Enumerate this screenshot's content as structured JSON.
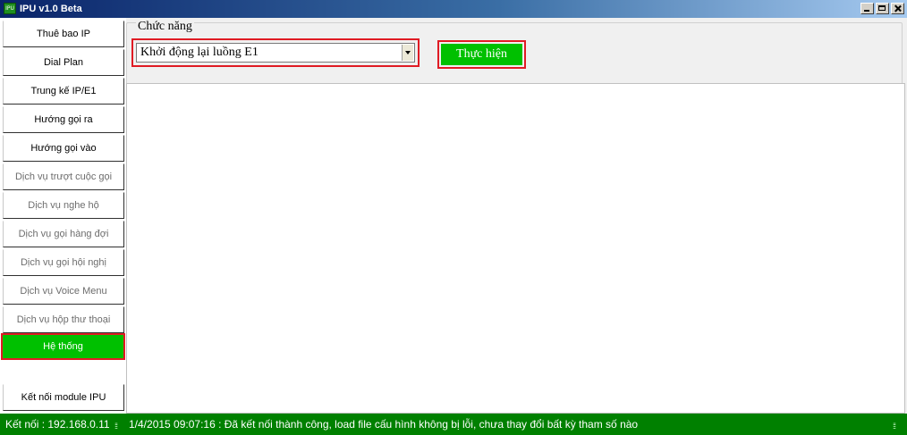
{
  "window": {
    "title": "IPU v1.0 Beta",
    "icon": "app-icon",
    "icon_text": "IPU"
  },
  "sidebar": {
    "items": [
      {
        "label": "Thuê bao IP",
        "state": "normal"
      },
      {
        "label": "Dial Plan",
        "state": "normal"
      },
      {
        "label": "Trung kế IP/E1",
        "state": "normal"
      },
      {
        "label": "Hướng gọi ra",
        "state": "normal"
      },
      {
        "label": "Hướng gọi vào",
        "state": "normal"
      },
      {
        "label": "Dịch vụ trượt cuộc gọi",
        "state": "disabled"
      },
      {
        "label": "Dịch vụ nghe hộ",
        "state": "disabled"
      },
      {
        "label": "Dịch vụ gọi hàng đợi",
        "state": "disabled"
      },
      {
        "label": "Dịch vụ gọi hội nghị",
        "state": "disabled"
      },
      {
        "label": "Dịch vụ Voice Menu",
        "state": "disabled"
      },
      {
        "label": "Dịch vụ hộp thư thoại",
        "state": "disabled"
      },
      {
        "label": "Hệ thống",
        "state": "active"
      },
      {
        "label": "Kết nối module IPU",
        "state": "normal"
      }
    ]
  },
  "main": {
    "group_label": "Chức năng",
    "function_select": {
      "value": "Khởi động lại luồng E1"
    },
    "execute_label": "Thực hiện"
  },
  "status": {
    "connection": "Kết nối : 192.168.0.11",
    "message": "1/4/2015 09:07:16 : Đã kết nối thành công, load file cấu hình không bị lỗi, chưa thay đổi bất kỳ tham số nào"
  },
  "colors": {
    "accent_green": "#00c000",
    "status_green": "#008000",
    "highlight_red": "#e01b24"
  }
}
